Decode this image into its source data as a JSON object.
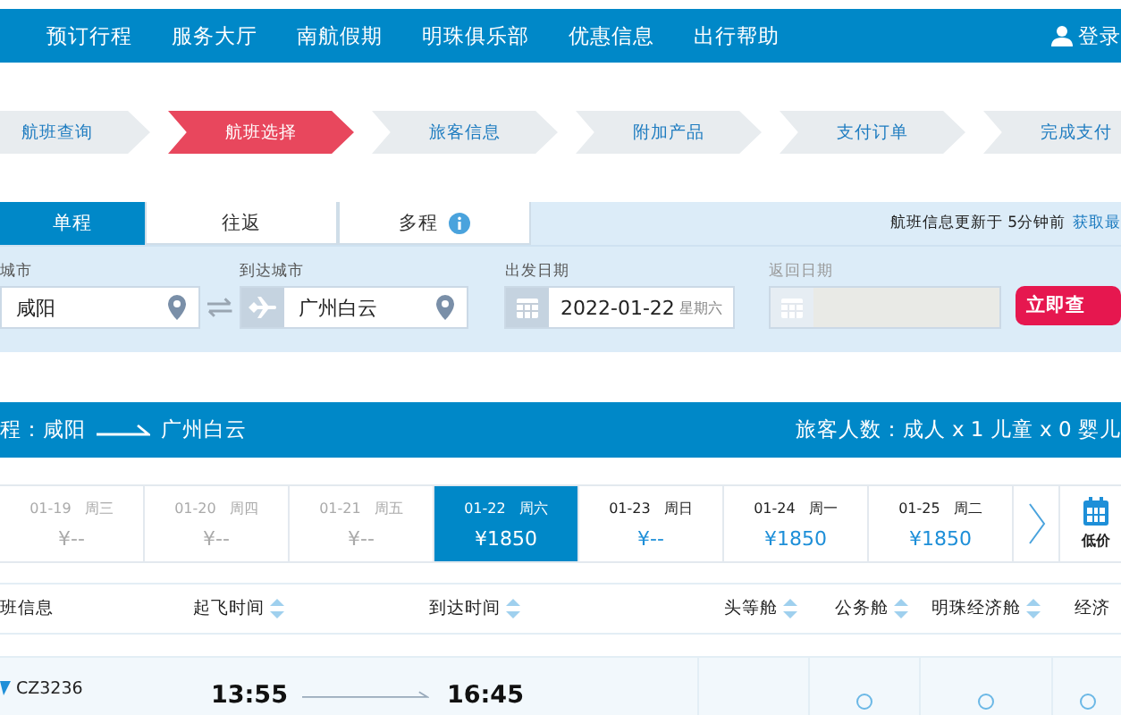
{
  "nav": {
    "items": [
      "预订行程",
      "服务大厅",
      "南航假期",
      "明珠俱乐部",
      "优惠信息",
      "出行帮助"
    ],
    "login": "登录"
  },
  "steps": [
    {
      "label": "航班查询",
      "selected": false
    },
    {
      "label": "航班选择",
      "selected": true
    },
    {
      "label": "旅客信息",
      "selected": false
    },
    {
      "label": "附加产品",
      "selected": false
    },
    {
      "label": "支付订单",
      "selected": false
    },
    {
      "label": "完成支付",
      "selected": false
    }
  ],
  "trip_tabs": [
    {
      "label": "单程",
      "selected": true,
      "info": false
    },
    {
      "label": "往返",
      "selected": false,
      "info": false
    },
    {
      "label": "多程",
      "selected": false,
      "info": true
    }
  ],
  "update_note": "航班信息更新于 5分钟前",
  "refresh_link": "获取最",
  "search": {
    "from_label": "城市",
    "from_value": "咸阳",
    "to_label": "到达城市",
    "to_value": "广州白云",
    "depart_label": "出发日期",
    "depart_value": "2022-01-22",
    "depart_weekday": "星期六",
    "return_label": "返回日期",
    "return_disabled": true,
    "search_button": "立即查"
  },
  "route": {
    "prefix": "程：",
    "from": "咸阳",
    "to": "广州白云",
    "passengers": "旅客人数：成人 x 1 儿童 x 0 婴儿"
  },
  "dates": [
    {
      "date": "01-19",
      "weekday": "周三",
      "price": "¥--",
      "disabled": true,
      "selected": false
    },
    {
      "date": "01-20",
      "weekday": "周四",
      "price": "¥--",
      "disabled": true,
      "selected": false
    },
    {
      "date": "01-21",
      "weekday": "周五",
      "price": "¥--",
      "disabled": true,
      "selected": false
    },
    {
      "date": "01-22",
      "weekday": "周六",
      "price": "¥1850",
      "disabled": false,
      "selected": true
    },
    {
      "date": "01-23",
      "weekday": "周日",
      "price": "¥--",
      "disabled": false,
      "selected": false
    },
    {
      "date": "01-24",
      "weekday": "周一",
      "price": "¥1850",
      "disabled": false,
      "selected": false
    },
    {
      "date": "01-25",
      "weekday": "周二",
      "price": "¥1850",
      "disabled": false,
      "selected": false
    }
  ],
  "calendar_label": "低价",
  "table": {
    "columns": [
      {
        "label": "班信息",
        "sortable": false
      },
      {
        "label": "起飞时间",
        "sortable": true
      },
      {
        "label": "到达时间",
        "sortable": true
      },
      {
        "label": "头等舱",
        "sortable": true
      },
      {
        "label": "公务舱",
        "sortable": true
      },
      {
        "label": "明珠经济舱",
        "sortable": true
      },
      {
        "label": "经济",
        "sortable": false
      }
    ],
    "rows": [
      {
        "flight": "CZ3236",
        "depart": "13:55",
        "arrive": "16:45",
        "fares": [
          {
            "kind": "none"
          },
          {
            "kind": "radio",
            "selected": false
          },
          {
            "kind": "radio",
            "selected": false
          },
          {
            "kind": "radio",
            "selected": false
          }
        ]
      }
    ]
  }
}
